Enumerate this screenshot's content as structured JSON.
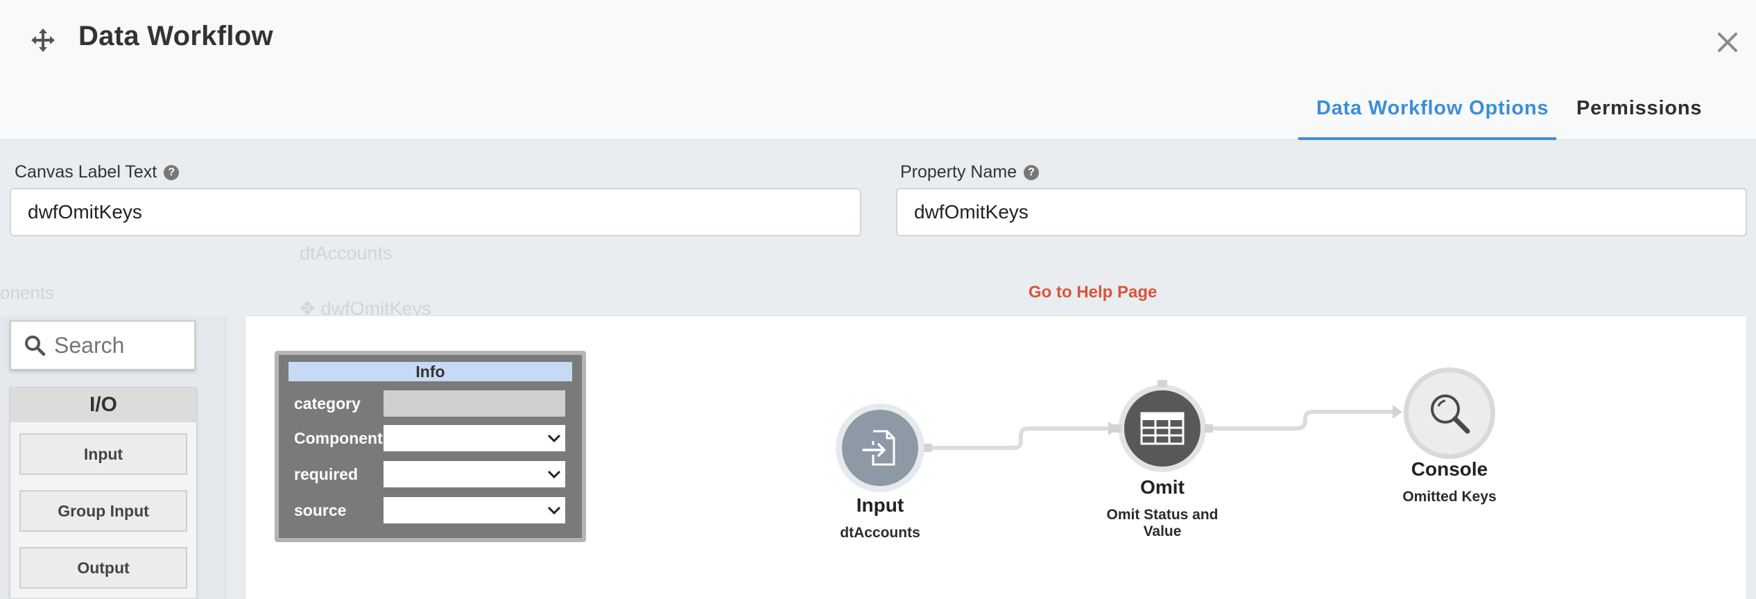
{
  "header": {
    "title": "Data Workflow",
    "tabs": [
      {
        "label": "Data Workflow Options",
        "active": true
      },
      {
        "label": "Permissions",
        "active": false
      }
    ]
  },
  "form": {
    "canvas_label": {
      "label": "Canvas Label Text",
      "value": "dwfOmitKeys"
    },
    "property_name": {
      "label": "Property Name",
      "value": "dwfOmitKeys"
    },
    "help_link": "Go to Help Page"
  },
  "background_ghost": {
    "components_text": "onents",
    "dt_accounts": "dtAccounts",
    "workflow_name": "dwfOmitKeys"
  },
  "palette": {
    "search_placeholder": "Search",
    "section_title": "I/O",
    "items": [
      "Input",
      "Group Input",
      "Output"
    ]
  },
  "info_panel": {
    "title": "Info",
    "rows": [
      {
        "key": "category",
        "type": "readonly",
        "value": ""
      },
      {
        "key": "Component",
        "type": "select",
        "value": ""
      },
      {
        "key": "required",
        "type": "select",
        "value": ""
      },
      {
        "key": "source",
        "type": "select",
        "value": ""
      }
    ]
  },
  "nodes": [
    {
      "title": "Input",
      "subtitle": "dtAccounts",
      "icon": "file-import-icon",
      "color": "#8d9aa6"
    },
    {
      "title": "Omit",
      "subtitle": "Omit Status and Value",
      "icon": "table-icon",
      "color": "#585858"
    },
    {
      "title": "Console",
      "subtitle": "Omitted Keys",
      "icon": "magnifier-icon",
      "color": "#ececec"
    }
  ],
  "colors": {
    "accent": "#3b8ed8",
    "help_link": "#d9533a",
    "info_header": "#c6daf3"
  }
}
